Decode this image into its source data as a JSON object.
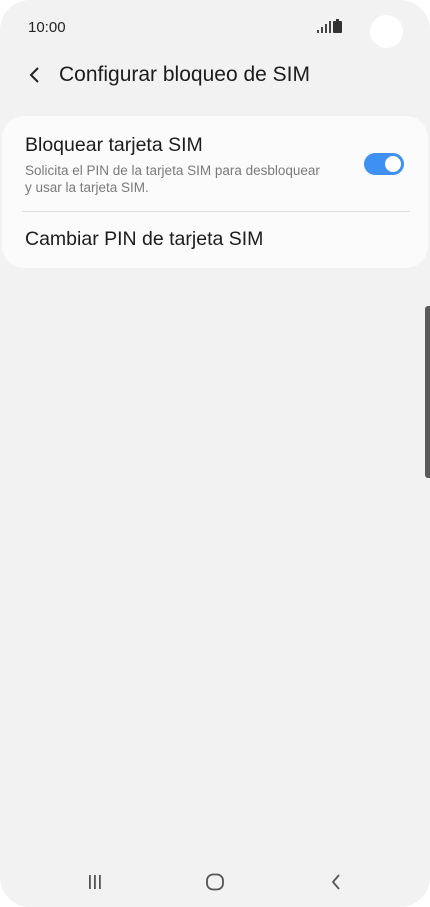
{
  "status_bar": {
    "time": "10:00"
  },
  "header": {
    "title": "Configurar bloqueo de SIM",
    "back_icon": "chevron-left-icon"
  },
  "settings": {
    "lock_sim": {
      "title": "Bloquear tarjeta SIM",
      "description": "Solicita el PIN de la tarjeta SIM para desbloquear y usar la tarjeta SIM.",
      "enabled": true
    },
    "change_pin": {
      "title": "Cambiar PIN de tarjeta SIM"
    }
  },
  "nav": {
    "recents_icon": "recents-icon",
    "home_icon": "home-icon",
    "back_icon": "back-icon"
  },
  "colors": {
    "accent": "#3e91f0",
    "background": "#f2f2f2",
    "card": "#fbfbfb"
  }
}
